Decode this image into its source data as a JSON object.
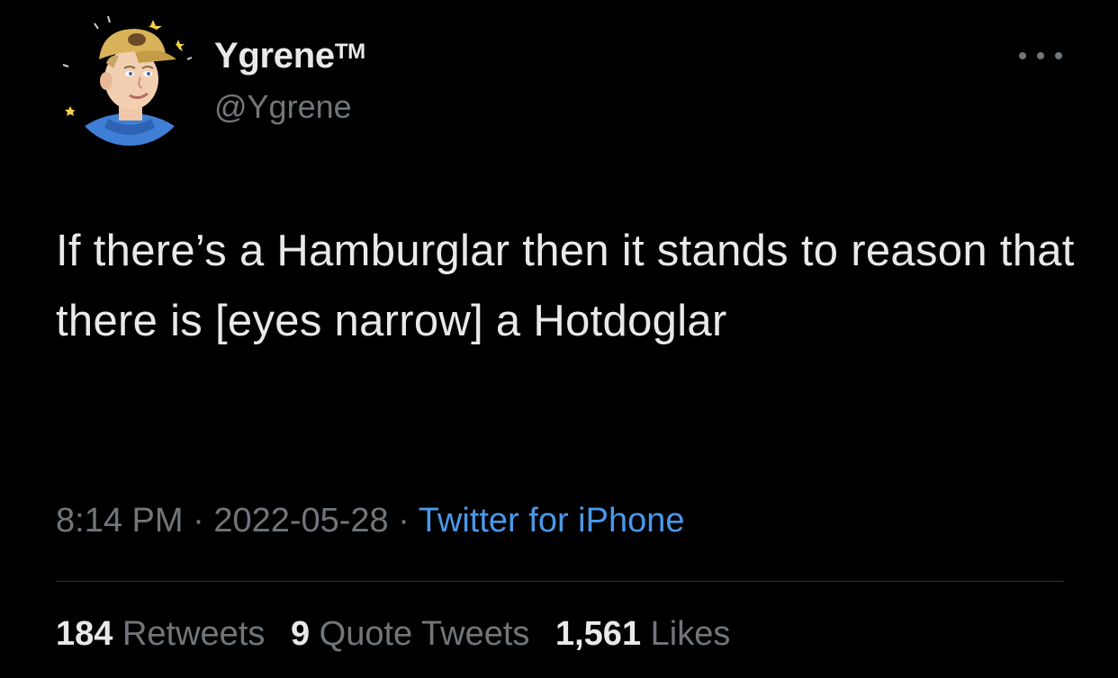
{
  "user": {
    "name": "Ygrene",
    "trademark": "TM",
    "handle": "@Ygrene",
    "avatar_icon": "cartoon-avatar-icon"
  },
  "tweet": {
    "text": "If there’s a Hamburglar then it stands to reason that there is [eyes narrow] a Hotdoglar",
    "time": "8:14 PM",
    "date": "2022-05-28",
    "separator": "·",
    "source": "Twitter for iPhone"
  },
  "stats": {
    "retweets_count": "184",
    "retweets_label": "Retweets",
    "quotes_count": "9",
    "quotes_label": "Quote Tweets",
    "likes_count": "1,561",
    "likes_label": "Likes"
  },
  "colors": {
    "background": "#000000",
    "text": "#e7e9ea",
    "muted": "#71767b",
    "link": "#4a99e9",
    "avatar_shirt": "#3f7fd6",
    "avatar_hat": "#d9b35a"
  }
}
